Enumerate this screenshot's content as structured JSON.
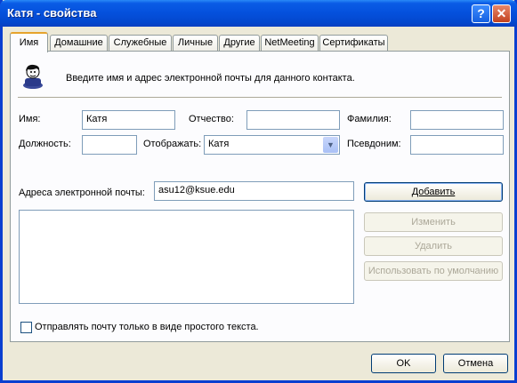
{
  "window": {
    "title": "Катя - свойства"
  },
  "titlebar": {
    "help_glyph": "?",
    "close_glyph": "✕"
  },
  "tabs": [
    {
      "label": "Имя"
    },
    {
      "label": "Домашние"
    },
    {
      "label": "Служебные"
    },
    {
      "label": "Личные"
    },
    {
      "label": "Другие"
    },
    {
      "label": "NetMeeting"
    },
    {
      "label": "Сертификаты"
    }
  ],
  "name_tab": {
    "intro": "Введите имя и адрес электронной почты для данного контакта.",
    "first_name": {
      "label": "Имя:",
      "value": "Катя"
    },
    "middle_name": {
      "label": "Отчество:",
      "value": ""
    },
    "last_name": {
      "label": "Фамилия:",
      "value": ""
    },
    "title": {
      "label": "Должность:",
      "value": ""
    },
    "display": {
      "label": "Отображать:",
      "value": "Катя"
    },
    "nickname": {
      "label": "Псевдоним:",
      "value": ""
    },
    "email": {
      "label": "Адреса электронной почты:",
      "value": "asu12@ksue.edu"
    },
    "buttons": {
      "add": "Добавить",
      "edit": "Изменить",
      "remove": "Удалить",
      "set_default": "Использовать по умолчанию"
    },
    "plain_text_checkbox": {
      "label": "Отправлять почту только в виде простого текста.",
      "checked": false
    }
  },
  "footer": {
    "ok": "OK",
    "cancel": "Отмена"
  },
  "colors": {
    "titlebar": "#0450dc",
    "face": "#ece9d8",
    "tab_highlight": "#e6a32c"
  }
}
